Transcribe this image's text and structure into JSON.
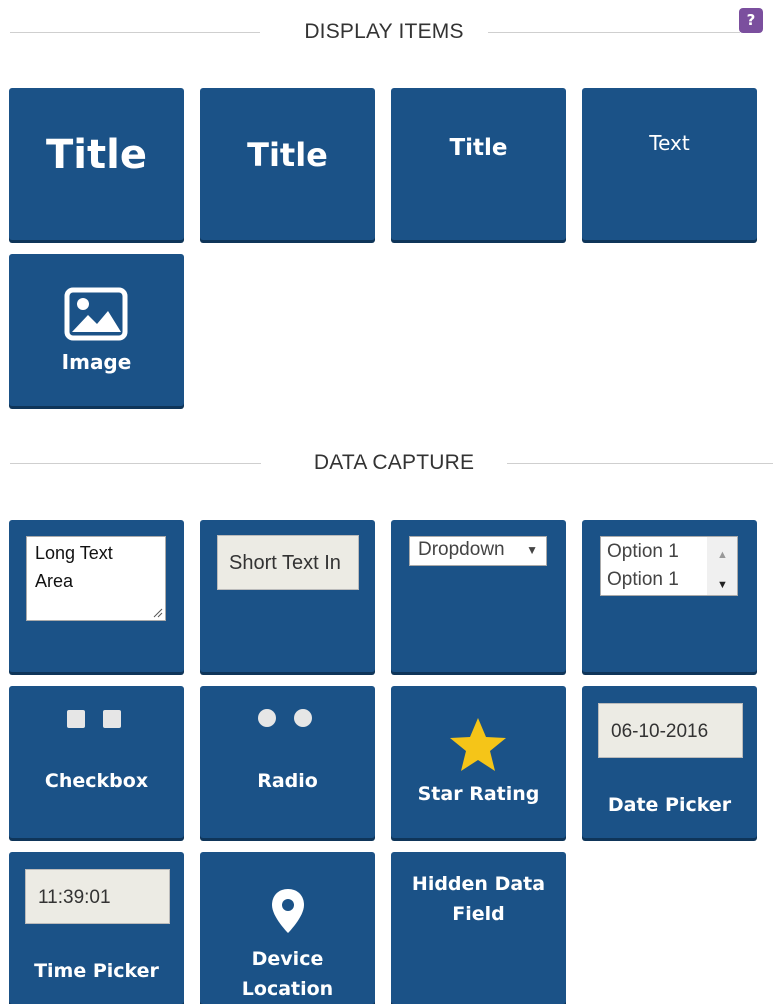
{
  "sections": {
    "display": "DISPLAY ITEMS",
    "capture": "DATA CAPTURE"
  },
  "help_label": "?",
  "display_items": {
    "title_large": "Title",
    "title_medium": "Title",
    "title_small": "Title",
    "text": "Text",
    "image": "Image"
  },
  "data_capture": {
    "long_text_area": {
      "line1": "Long Text",
      "line2": "Area"
    },
    "short_text_input": "Short Text In",
    "dropdown": "Dropdown",
    "listbox": {
      "option1": "Option 1",
      "option2": "Option 1"
    },
    "checkbox": "Checkbox",
    "radio": "Radio",
    "star_rating": "Star Rating",
    "date_picker": {
      "value": "06-10-2016",
      "label": "Date Picker"
    },
    "time_picker": {
      "value": "11:39:01",
      "label": "Time Picker"
    },
    "device_location": {
      "line1": "Device",
      "line2": "Location"
    },
    "hidden_data_field": {
      "line1": "Hidden Data",
      "line2": "Field"
    }
  },
  "icons": {
    "help": "help-icon",
    "image": "image-icon",
    "star": "star-icon",
    "location": "location-pin-icon",
    "dropdown_arrow": "dropdown-arrow-icon"
  },
  "colors": {
    "tile_bg": "#1b5287",
    "help_bg": "#7b4f9e",
    "star": "#f5c518",
    "input_bg": "#ecebe4"
  }
}
